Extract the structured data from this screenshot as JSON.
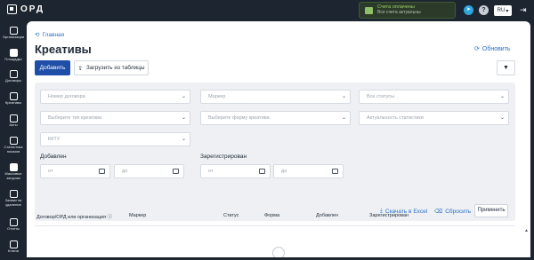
{
  "topbar": {
    "logo_text": "ОРД",
    "account_title": "Счета оплачены",
    "account_sub": "Все счета актуальны",
    "lang": "RU",
    "help_label": "?"
  },
  "sidebar": {
    "items": [
      {
        "label": "Организации"
      },
      {
        "label": "Площадки"
      },
      {
        "label": "Договоры"
      },
      {
        "label": "Креативы"
      },
      {
        "label": "Акты"
      },
      {
        "label": "Статистика показов"
      },
      {
        "label": "Массовые загрузки"
      },
      {
        "label": "Заявки на удаление"
      },
      {
        "label": "Отчеты"
      },
      {
        "label": "Ключи"
      }
    ]
  },
  "main": {
    "breadcrumb": "Главная",
    "title": "Креативы",
    "refresh": "Обновить",
    "add_button": "Добавить",
    "upload_button": "Загрузить из таблицы"
  },
  "filters": {
    "contract_number": "Номер договора",
    "marker": "Маркер",
    "all_statuses": "Все статусы",
    "creative_type": "Выберите тип креатива",
    "creative_form": "Выберите форму креатива",
    "stats_relevance": "Актуальность статистики",
    "kktu": "ККТУ",
    "added_label": "Добавлен",
    "registered_label": "Зарегистрирован",
    "from": "от",
    "to": "до",
    "excel": "Скачать в Excel",
    "reset": "Сбросить",
    "apply": "Применить"
  },
  "table": {
    "columns": [
      "Договор/ОРД или организация",
      "Маркер",
      "Статус",
      "Форма",
      "Добавлен",
      "Зарегистрирован"
    ]
  },
  "colors": {
    "sidebar_bg": "#1c2530",
    "accent": "#1f4ea8",
    "link": "#2a6fc9",
    "account_ok": "#9ed36a"
  }
}
